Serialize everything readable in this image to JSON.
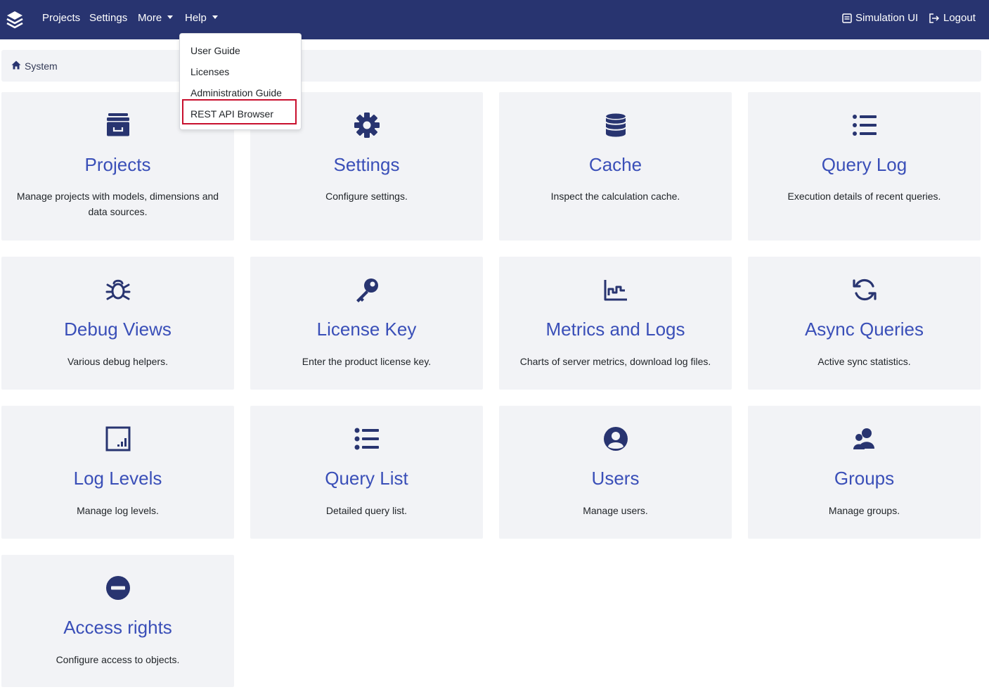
{
  "navbar": {
    "brand_icon": "layers-icon",
    "bg_color": "#283470",
    "items": [
      {
        "label": "Projects"
      },
      {
        "label": "Settings"
      },
      {
        "label": "More"
      },
      {
        "label": "Help"
      }
    ],
    "simulation_label": "Simulation UI",
    "logout_label": "Logout"
  },
  "help_menu": {
    "items": [
      {
        "label": "User Guide"
      },
      {
        "label": "Licenses"
      },
      {
        "label": "Administration Guide"
      },
      {
        "label": "REST API Browser",
        "highlighted": true
      }
    ],
    "highlight_color": "#c8102e"
  },
  "breadcrumb": {
    "icon": "home-icon",
    "label": "System"
  },
  "accent_color": "#3a4fb8",
  "icon_color": "#283470",
  "cards": [
    {
      "icon": "archive-box-icon",
      "title": "Projects",
      "desc": "Manage projects with models, dimensions and data sources."
    },
    {
      "icon": "gear-icon",
      "title": "Settings",
      "desc": "Configure settings."
    },
    {
      "icon": "database-icon",
      "title": "Cache",
      "desc": "Inspect the calculation cache."
    },
    {
      "icon": "list-icon",
      "title": "Query Log",
      "desc": "Execution details of recent queries."
    },
    {
      "icon": "bug-icon",
      "title": "Debug Views",
      "desc": "Various debug helpers."
    },
    {
      "icon": "key-icon",
      "title": "License Key",
      "desc": "Enter the product license key."
    },
    {
      "icon": "chart-line-icon",
      "title": "Metrics and Logs",
      "desc": "Charts of server metrics, download log files."
    },
    {
      "icon": "sync-icon",
      "title": "Async Queries",
      "desc": "Active sync statistics."
    },
    {
      "icon": "log-levels-icon",
      "title": "Log Levels",
      "desc": "Manage log levels."
    },
    {
      "icon": "list-bullets-icon",
      "title": "Query List",
      "desc": "Detailed query list."
    },
    {
      "icon": "user-circle-icon",
      "title": "Users",
      "desc": "Manage users."
    },
    {
      "icon": "users-group-icon",
      "title": "Groups",
      "desc": "Manage groups."
    },
    {
      "icon": "minus-circle-icon",
      "title": "Access rights",
      "desc": "Configure access to objects."
    }
  ]
}
